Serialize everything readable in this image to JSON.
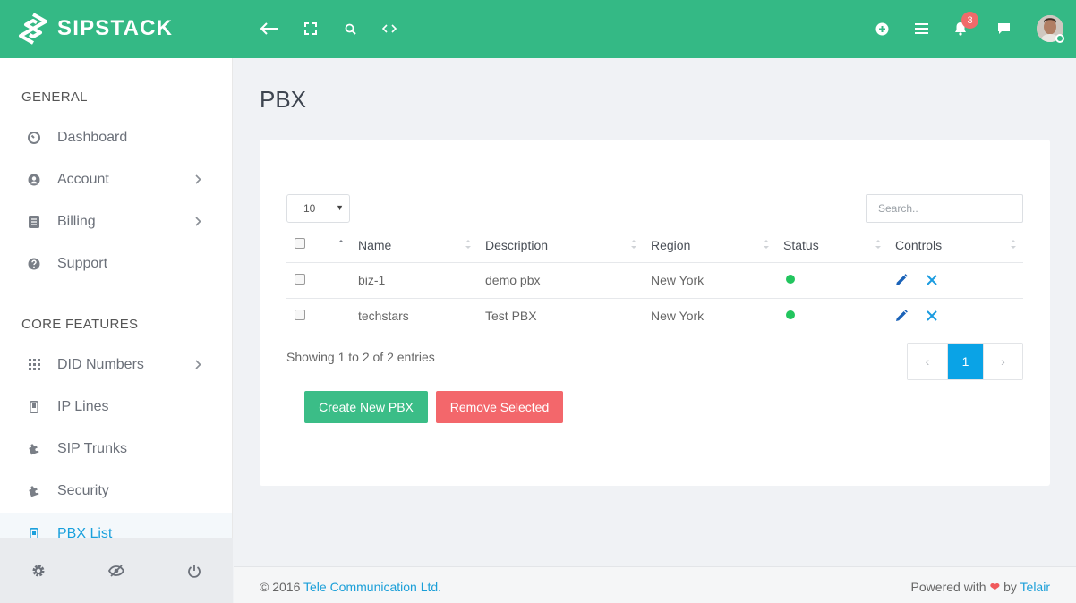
{
  "brand": {
    "name": "SIPSTACK",
    "color": "#34b985"
  },
  "topbar": {
    "left_icons": [
      "arrow-left-icon",
      "expand-icon",
      "search-icon",
      "code-icon"
    ],
    "right_icons": [
      "plus-circle-icon",
      "menu-icon",
      "bell-icon",
      "chat-icon"
    ],
    "notification_count": "3"
  },
  "sidebar": {
    "general_heading": "GENERAL",
    "general_items": [
      {
        "label": "Dashboard",
        "icon": "dashboard-icon",
        "has_submenu": false
      },
      {
        "label": "Account",
        "icon": "user-circle-icon",
        "has_submenu": true
      },
      {
        "label": "Billing",
        "icon": "receipt-icon",
        "has_submenu": true
      },
      {
        "label": "Support",
        "icon": "question-icon",
        "has_submenu": false
      }
    ],
    "core_heading": "CORE FEATURES",
    "core_items": [
      {
        "label": "DID Numbers",
        "icon": "grid-icon",
        "has_submenu": true
      },
      {
        "label": "IP Lines",
        "icon": "phone-icon",
        "has_submenu": false
      },
      {
        "label": "SIP Trunks",
        "icon": "puzzle-icon",
        "has_submenu": false
      },
      {
        "label": "Security",
        "icon": "puzzle-icon",
        "has_submenu": false
      },
      {
        "label": "PBX List",
        "icon": "phone-icon",
        "has_submenu": false,
        "active": true
      }
    ],
    "bottom_icons": [
      "gear-icon",
      "eye-slash-icon",
      "power-icon"
    ]
  },
  "page": {
    "title": "PBX"
  },
  "table": {
    "length_value": "10",
    "search_placeholder": "Search..",
    "columns": [
      "Name",
      "Description",
      "Region",
      "Status",
      "Controls"
    ],
    "rows": [
      {
        "name": "biz-1",
        "description": "demo pbx",
        "region": "New York",
        "status": "active"
      },
      {
        "name": "techstars",
        "description": "Test PBX",
        "region": "New York",
        "status": "active"
      }
    ],
    "info": "Showing 1 to 2 of 2 entries",
    "pagination": {
      "prev": "‹",
      "current": "1",
      "next": "›"
    }
  },
  "actions": {
    "create_label": "Create New PBX",
    "remove_label": "Remove Selected"
  },
  "footer": {
    "copyright_prefix": "© 2016 ",
    "company": "Tele Communication Ltd.",
    "powered_prefix": "Powered with ",
    "powered_by": " by ",
    "powered_name": "Telair"
  },
  "colors": {
    "accent": "#1aa0dc",
    "create": "#3bbd87",
    "remove": "#f3676b",
    "status_active": "#22c55e",
    "badge": "#f06a6a"
  }
}
